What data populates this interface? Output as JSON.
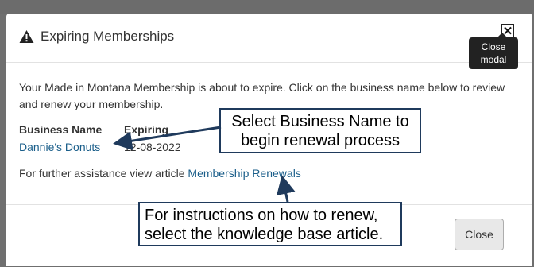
{
  "modal": {
    "title": "Expiring Memberships",
    "close_icon": "✕",
    "close_tooltip_line1": "Close",
    "close_tooltip_line2": "modal",
    "message": "Your Made in Montana Membership is about to expire. Click on the business name below to review and renew your membership.",
    "table": {
      "headers": {
        "name": "Business Name",
        "expiring": "Expiring"
      },
      "rows": [
        {
          "name": "Dannie's Donuts",
          "expiring": "12-08-2022"
        }
      ]
    },
    "assist_text": "For further assistance view article ",
    "assist_link": "Membership Renewals",
    "close_button": "Close"
  },
  "annotations": {
    "callout1": "Select Business Name to begin renewal process",
    "callout2_line1": "For instructions on how to renew,",
    "callout2_line2": "select the knowledge base article."
  },
  "icons": {
    "title_icon": "warning-icon"
  },
  "colors": {
    "link": "#1a5e8a",
    "callout_border": "#1f3a5c",
    "tooltip": "#222222"
  }
}
